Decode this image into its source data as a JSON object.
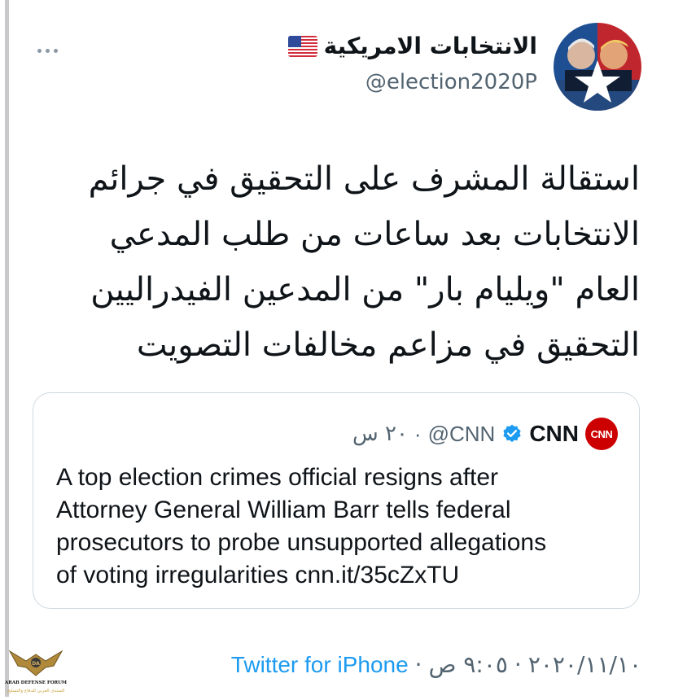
{
  "author": {
    "display_name": "الانتخابات الامريكية",
    "handle": "@election2020P"
  },
  "tweet": {
    "lines": [
      "استقالة المشرف على التحقيق في جرائم",
      "الانتخابات بعد ساعات من طلب المدعي",
      "العام \"ويليام بار\" من المدعين الفيدراليين",
      "التحقيق في مزاعم مخالفات التصويت"
    ]
  },
  "quote": {
    "logo_text": "CNN",
    "name": "CNN",
    "handle": "@CNN",
    "time": "٢٠ س",
    "lines": [
      "A top election crimes official resigns after",
      "Attorney General William Barr tells federal",
      "prosecutors to probe unsupported allegations",
      "of voting irregularities cnn.it/35cZxTU"
    ]
  },
  "meta": {
    "date": "٢٠٢٠/١١/١٠",
    "time": "٩:٠٥ ص",
    "separator": "·",
    "source": "Twitter for iPhone"
  },
  "watermark": {
    "line1": "ARAB DEFENSE FORUM",
    "line2": "المنتدى العربي للدفاع والتسليح"
  },
  "colors": {
    "link": "#1d9bf0",
    "muted": "#536471",
    "verified": "#1d9bf0",
    "cnn_red": "#cc0000"
  }
}
